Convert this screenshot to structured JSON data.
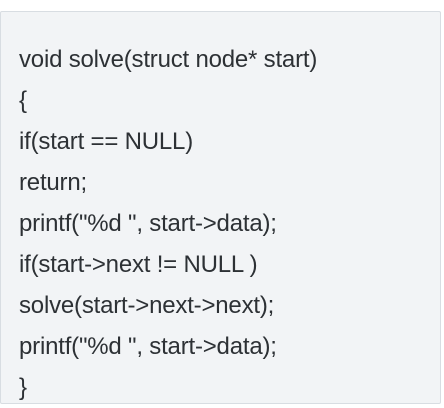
{
  "code_block": {
    "lines": [
      "void solve(struct node* start)",
      "{",
      "if(start == NULL)",
      "return;",
      "printf(\"%d \", start->data);",
      "if(start->next != NULL )",
      "solve(start->next->next);",
      "printf(\"%d \", start->data);",
      "}"
    ]
  },
  "colors": {
    "background": "#f2f4f6",
    "border": "#d8dde2",
    "text": "#2d3135"
  }
}
